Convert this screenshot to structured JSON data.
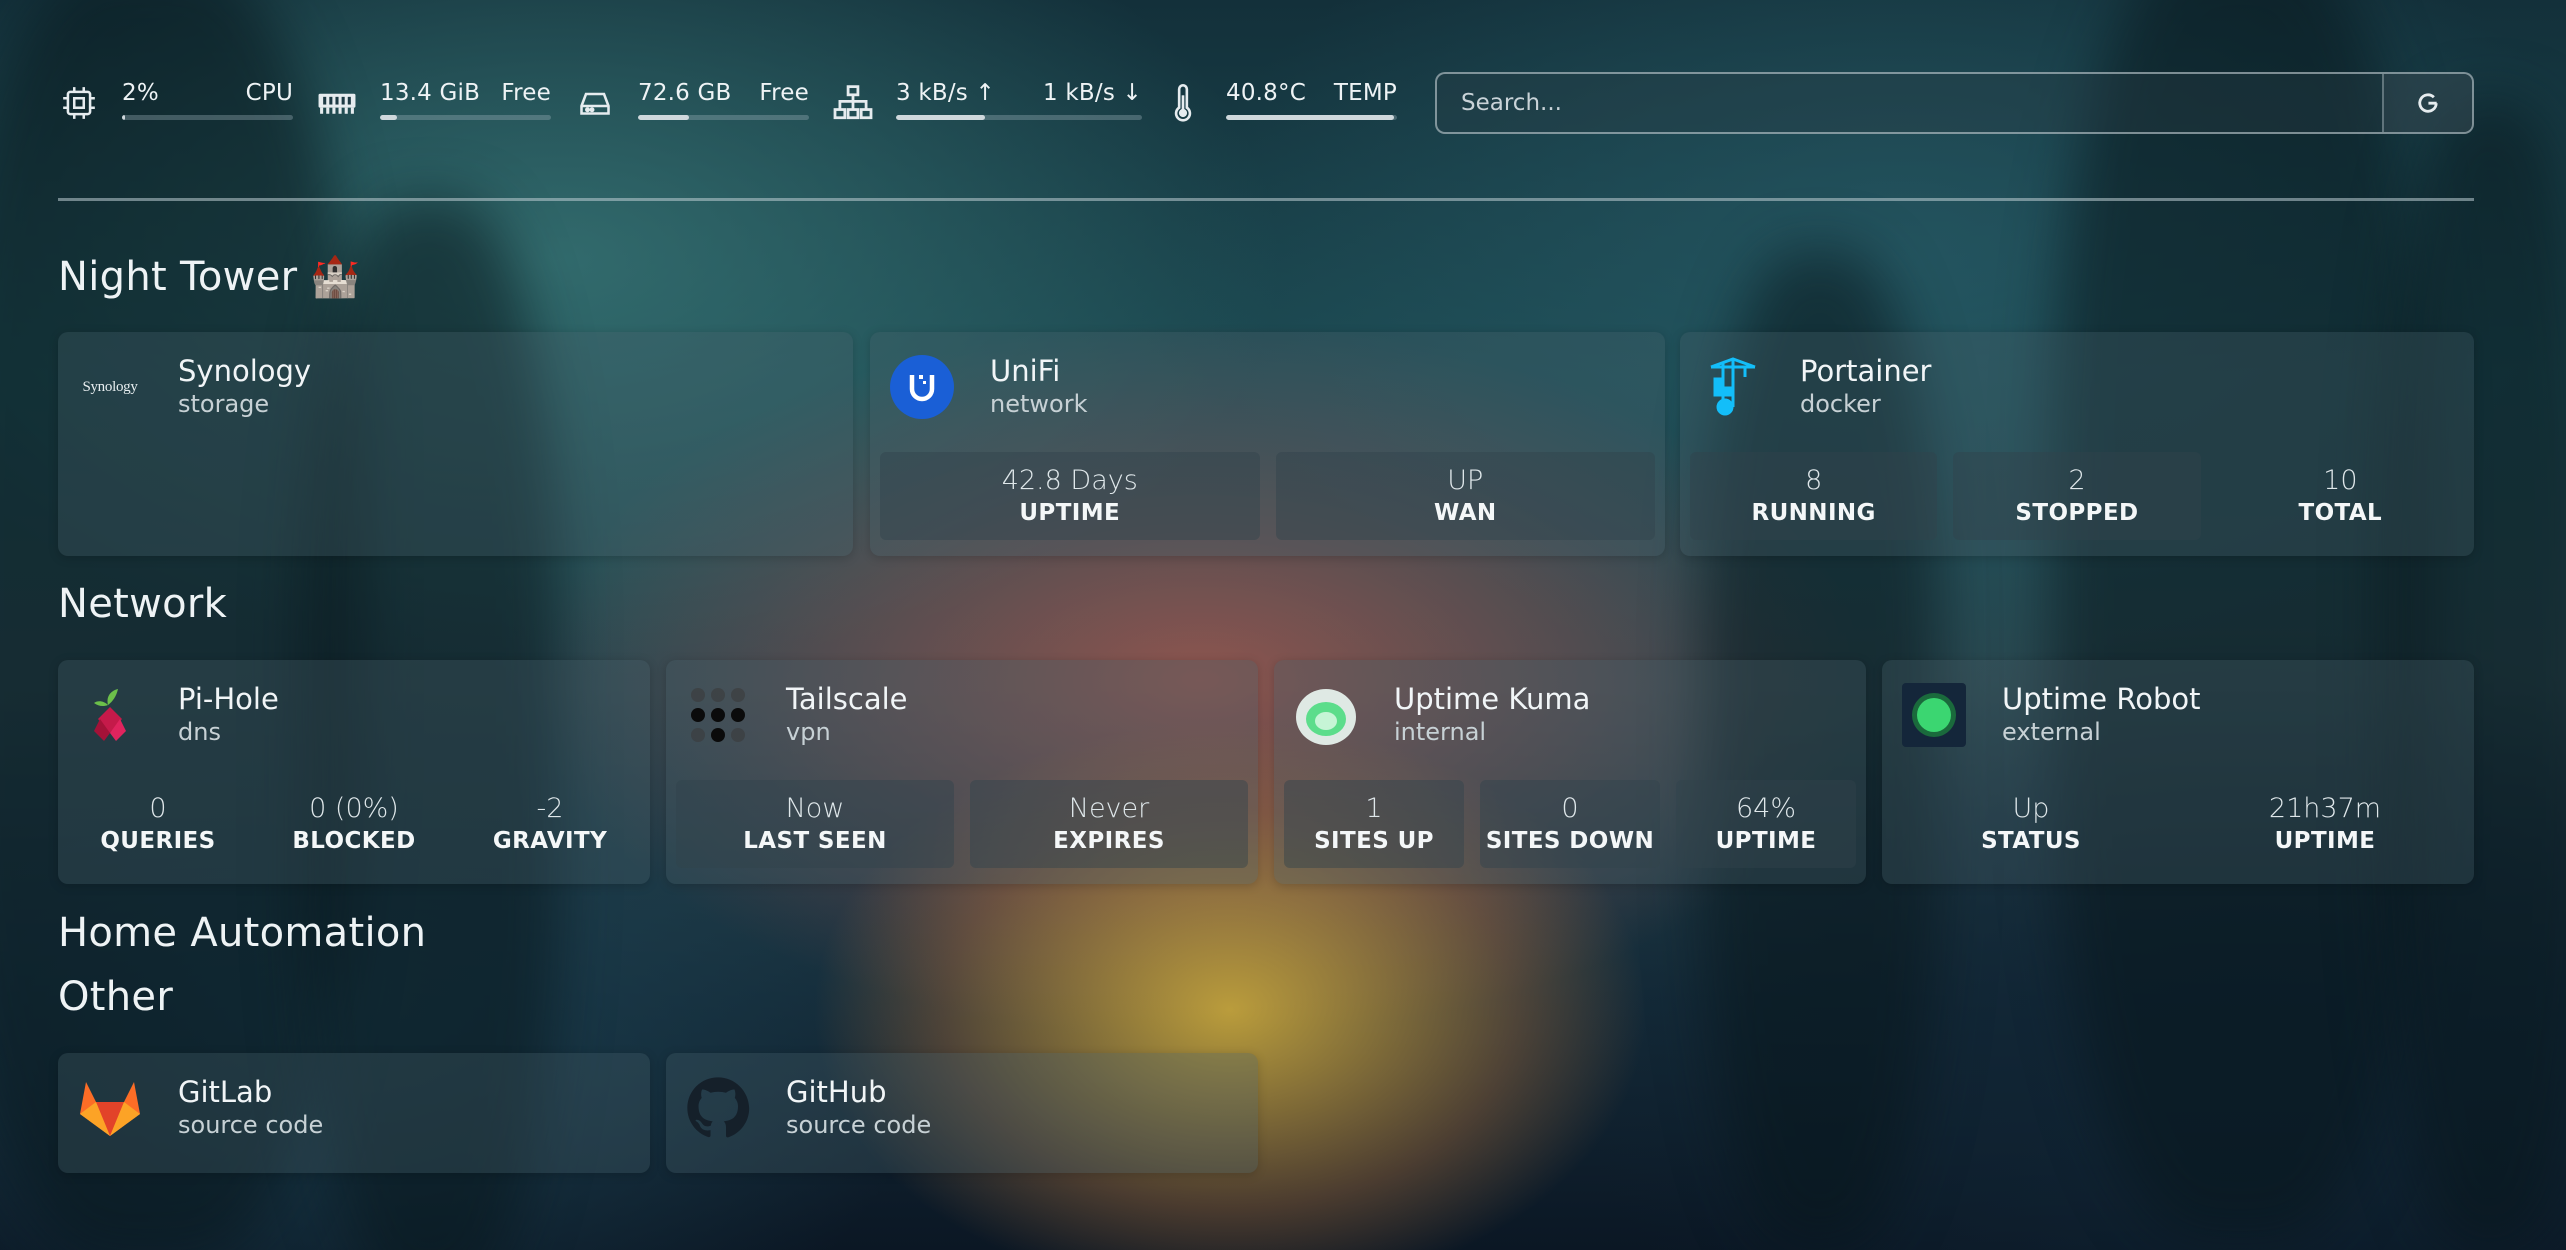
{
  "resources": {
    "cpu": {
      "value": "2%",
      "label": "CPU",
      "percent": 2
    },
    "memory": {
      "value": "13.4 GiB",
      "label": "Free",
      "percent": 10
    },
    "disk": {
      "value": "72.6 GB",
      "label": "Free",
      "percent": 30
    },
    "network": {
      "up": "3 kB/s ↑",
      "down": "1 kB/s ↓",
      "percent": 36
    },
    "temp": {
      "value": "40.8°C",
      "label": "TEMP",
      "percent": 98
    }
  },
  "search": {
    "placeholder": "Search...",
    "provider": "G"
  },
  "groups": {
    "night_tower": {
      "title": "Night Tower 🏰"
    },
    "network": {
      "title": "Network"
    },
    "home_automation": {
      "title": "Home Automation"
    },
    "other": {
      "title": "Other"
    }
  },
  "services": {
    "synology": {
      "name": "Synology",
      "desc": "storage",
      "logo_text": "Synology"
    },
    "unifi": {
      "name": "UniFi",
      "desc": "network",
      "widgets": [
        {
          "value": "42.8 Days",
          "label": "UPTIME"
        },
        {
          "value": "UP",
          "label": "WAN"
        }
      ]
    },
    "portainer": {
      "name": "Portainer",
      "desc": "docker",
      "widgets": [
        {
          "value": "8",
          "label": "RUNNING"
        },
        {
          "value": "2",
          "label": "STOPPED"
        },
        {
          "value": "10",
          "label": "TOTAL"
        }
      ]
    },
    "pihole": {
      "name": "Pi-Hole",
      "desc": "dns",
      "widgets": [
        {
          "value": "0",
          "label": "QUERIES"
        },
        {
          "value": "0 (0%)",
          "label": "BLOCKED"
        },
        {
          "value": "-2",
          "label": "GRAVITY"
        }
      ]
    },
    "tailscale": {
      "name": "Tailscale",
      "desc": "vpn",
      "widgets": [
        {
          "value": "Now",
          "label": "LAST SEEN"
        },
        {
          "value": "Never",
          "label": "EXPIRES"
        }
      ]
    },
    "uptime_kuma": {
      "name": "Uptime Kuma",
      "desc": "internal",
      "widgets": [
        {
          "value": "1",
          "label": "SITES UP"
        },
        {
          "value": "0",
          "label": "SITES DOWN"
        },
        {
          "value": "64%",
          "label": "UPTIME"
        }
      ]
    },
    "uptime_robot": {
      "name": "Uptime Robot",
      "desc": "external",
      "widgets": [
        {
          "value": "Up",
          "label": "STATUS"
        },
        {
          "value": "21h37m",
          "label": "UPTIME"
        }
      ]
    },
    "gitlab": {
      "name": "GitLab",
      "desc": "source code"
    },
    "github": {
      "name": "GitHub",
      "desc": "source code"
    }
  },
  "colors": {
    "unifi": "#1a5fd6",
    "portainer": "#13bef9",
    "pihole_red": "#c51a4a",
    "pihole_green": "#6cc04a",
    "kuma": "#5cdd8b",
    "robot": "#3bd671",
    "gitlab": "#fc6d26"
  }
}
